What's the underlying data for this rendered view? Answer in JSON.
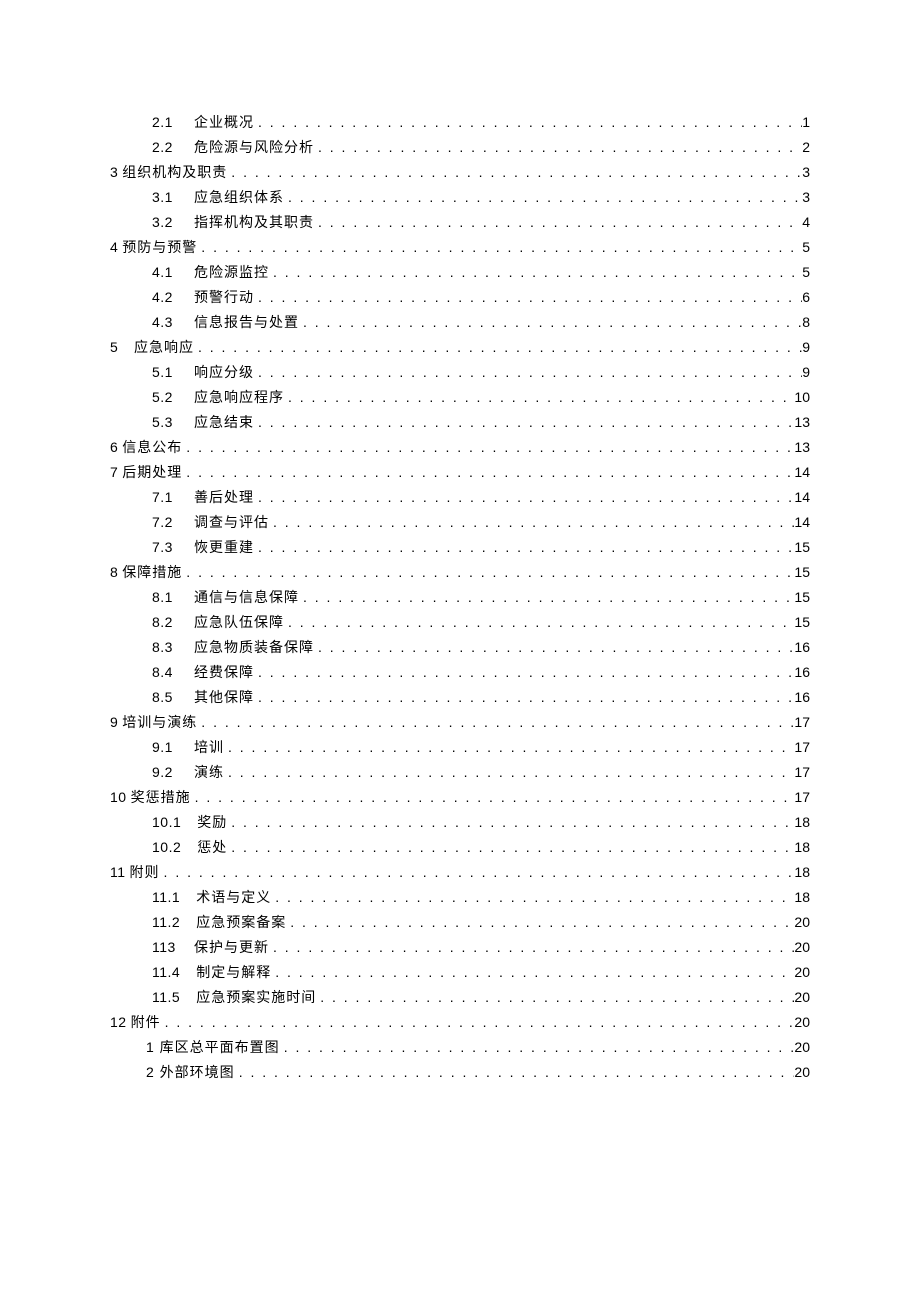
{
  "toc": [
    {
      "level": 2,
      "num": "2.1",
      "title": "企业概况",
      "page": "1"
    },
    {
      "level": 2,
      "num": "2.2",
      "title": "危险源与风险分析",
      "page": "2"
    },
    {
      "level": 1,
      "num": "3",
      "title": "组织机构及职责",
      "page": "3"
    },
    {
      "level": 2,
      "num": "3.1",
      "title": "应急组织体系",
      "page": "3"
    },
    {
      "level": 2,
      "num": "3.2",
      "title": "指挥机构及其职责",
      "page": "4"
    },
    {
      "level": 1,
      "num": "4",
      "title": "预防与预警",
      "page": "5"
    },
    {
      "level": 2,
      "num": "4.1",
      "title": "危险源监控",
      "page": "5"
    },
    {
      "level": 2,
      "num": "4.2",
      "title": "预警行动",
      "page": "6"
    },
    {
      "level": 2,
      "num": "4.3",
      "title": "信息报告与处置",
      "page": "8"
    },
    {
      "level": 1,
      "num": "5",
      "title": "应急响应",
      "page": "9",
      "spaced": true
    },
    {
      "level": 2,
      "num": "5.1",
      "title": "响应分级",
      "page": "9"
    },
    {
      "level": 2,
      "num": "5.2",
      "title": "应急响应程序",
      "page": "10"
    },
    {
      "level": 2,
      "num": "5.3",
      "title": "应急结束",
      "page": "13"
    },
    {
      "level": 1,
      "num": "6",
      "title": "信息公布",
      "page": "13"
    },
    {
      "level": 1,
      "num": "7",
      "title": "后期处理",
      "page": "14"
    },
    {
      "level": 2,
      "num": "7.1",
      "title": "善后处理",
      "page": "14"
    },
    {
      "level": 2,
      "num": "7.2",
      "title": "调查与评估",
      "page": "14"
    },
    {
      "level": 2,
      "num": "7.3",
      "title": "恢更重建",
      "page": "15"
    },
    {
      "level": 1,
      "num": "8",
      "title": "保障措施",
      "page": "15"
    },
    {
      "level": 2,
      "num": "8.1",
      "title": "通信与信息保障",
      "page": "15"
    },
    {
      "level": 2,
      "num": "8.2",
      "title": "应急队伍保障",
      "page": "15"
    },
    {
      "level": 2,
      "num": "8.3",
      "title": "应急物质装备保障",
      "page": "16"
    },
    {
      "level": 2,
      "num": "8.4",
      "title": "经费保障",
      "page": "16"
    },
    {
      "level": 2,
      "num": "8.5",
      "title": "其他保障",
      "page": "16"
    },
    {
      "level": 1,
      "num": "9",
      "title": "培训与演练",
      "page": "17"
    },
    {
      "level": 2,
      "num": "9.1",
      "title": "培训",
      "page": "17"
    },
    {
      "level": 2,
      "num": "9.2",
      "title": "演练",
      "page": "17"
    },
    {
      "level": 1,
      "num": "10",
      "title": "奖惩措施",
      "page": "17"
    },
    {
      "level": 2,
      "num": "10.1",
      "title": "奖励",
      "page": "18"
    },
    {
      "level": 2,
      "num": "10.2",
      "title": "惩处",
      "page": "18"
    },
    {
      "level": 1,
      "num": "11",
      "title": "附则",
      "page": "18"
    },
    {
      "level": 2,
      "num": "11.1",
      "title": "术语与定义",
      "page": "18"
    },
    {
      "level": 2,
      "num": "11.2",
      "title": "应急预案备案",
      "page": "20"
    },
    {
      "level": 2,
      "num": "113",
      "title": "保护与更新",
      "page": "20"
    },
    {
      "level": 2,
      "num": "11.4",
      "title": "制定与解释",
      "page": "20"
    },
    {
      "level": 2,
      "num": "11.5",
      "title": "应急预案实施时间",
      "page": "20"
    },
    {
      "level": 1,
      "num": "12",
      "title": "附件",
      "page": "20"
    },
    {
      "level": 2,
      "num": "",
      "title": "1 库区总平面布置图",
      "page": "20",
      "alt": true
    },
    {
      "level": 2,
      "num": "",
      "title": "2 外部环境图",
      "page": "20",
      "alt": true
    }
  ]
}
